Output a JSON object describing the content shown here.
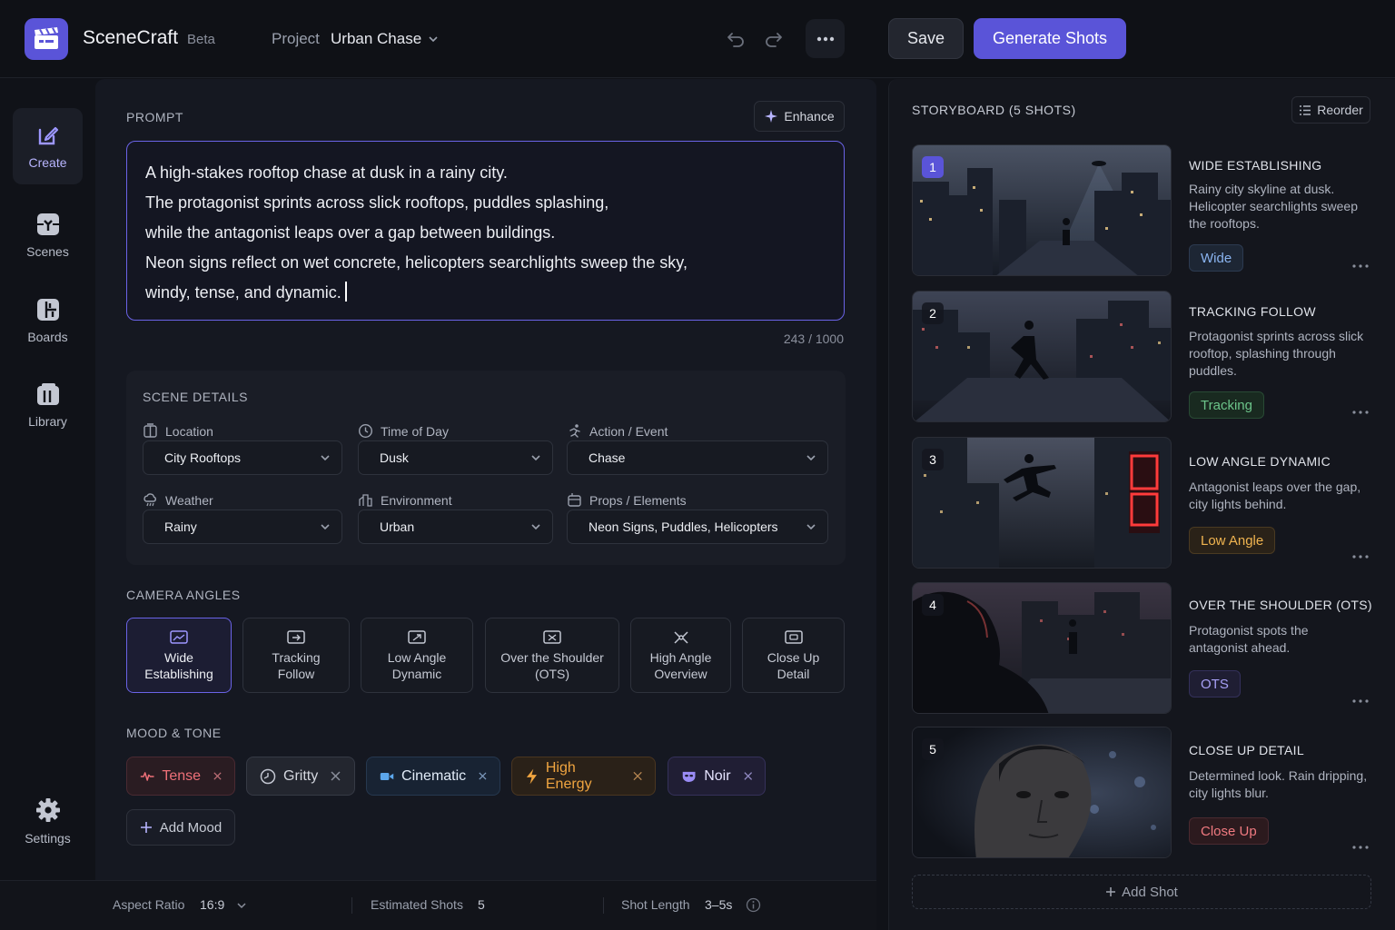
{
  "app": {
    "name": "SceneCraft",
    "badge": "Beta"
  },
  "project": {
    "label": "Project",
    "name": "Urban Chase"
  },
  "header": {
    "save_label": "Save",
    "generate_label": "Generate Shots"
  },
  "nav": {
    "items": [
      {
        "label": "Create",
        "icon": "edit-icon",
        "active": true
      },
      {
        "label": "Scenes",
        "icon": "scenes-icon"
      },
      {
        "label": "Boards",
        "icon": "boards-icon"
      },
      {
        "label": "Library",
        "icon": "library-icon"
      }
    ],
    "settings_label": "Settings"
  },
  "prompt": {
    "title": "PROMPT",
    "enhance_label": "Enhance",
    "lines": [
      "A high-stakes rooftop chase at dusk in a rainy city.",
      "The protagonist sprints across slick rooftops, puddles splashing,",
      "while the antagonist leaps over a gap between buildings.",
      "Neon signs reflect on wet concrete, helicopters searchlights sweep the sky,",
      "windy, tense, and dynamic."
    ],
    "counter": "243 / 1000"
  },
  "scene_details": {
    "title": "SCENE DETAILS",
    "fields": [
      {
        "label": "Location",
        "value": "City Rooftops"
      },
      {
        "label": "Time of Day",
        "value": "Dusk"
      },
      {
        "label": "Action / Event",
        "value": "Chase"
      },
      {
        "label": "Weather",
        "value": "Rainy"
      },
      {
        "label": "Environment",
        "value": "Urban"
      },
      {
        "label": "Props / Elements",
        "value": "Neon Signs, Puddles, Helicopters"
      }
    ]
  },
  "camera_angles": {
    "title": "CAMERA ANGLES",
    "items": [
      {
        "line1": "Wide",
        "line2": "Establishing",
        "selected": true
      },
      {
        "line1": "Tracking",
        "line2": "Follow"
      },
      {
        "line1": "Low Angle",
        "line2": "Dynamic"
      },
      {
        "line1": "Over the Shoulder",
        "line2": "(OTS)"
      },
      {
        "line1": "High Angle",
        "line2": "Overview"
      },
      {
        "line1": "Close Up",
        "line2": "Detail"
      }
    ]
  },
  "mood": {
    "title": "MOOD & TONE",
    "chips": [
      {
        "label": "Tense",
        "color": "#e8646e"
      },
      {
        "label": "Gritty",
        "color": "#c8ccd6"
      },
      {
        "label": "Cinematic",
        "color": "#5ca7ec"
      },
      {
        "label": "High Energy",
        "color": "#f0a540"
      },
      {
        "label": "Noir",
        "color": "#9a8cf5"
      }
    ],
    "add_label": "Add Mood"
  },
  "footer": {
    "aspect_label": "Aspect Ratio",
    "aspect_value": "16:9",
    "shots_label": "Estimated Shots",
    "shots_value": "5",
    "length_label": "Shot Length",
    "length_value": "3–5s"
  },
  "storyboard": {
    "title": "STORYBOARD (5 SHOTS)",
    "reorder_label": "Reorder",
    "add_label": "Add Shot",
    "shots": [
      {
        "num": "1",
        "title": "WIDE ESTABLISHING",
        "desc": "Rainy city skyline at dusk. Helicopter searchlights sweep the rooftops.",
        "tag": "Wide",
        "tag_color": "#8ab4f0"
      },
      {
        "num": "2",
        "title": "TRACKING FOLLOW",
        "desc": "Protagonist sprints across slick rooftop, splashing through puddles.",
        "tag": "Tracking",
        "tag_color": "#6cc48a"
      },
      {
        "num": "3",
        "title": "LOW ANGLE DYNAMIC",
        "desc": "Antagonist leaps over the gap, city lights behind.",
        "tag": "Low Angle",
        "tag_color": "#f0b450"
      },
      {
        "num": "4",
        "title": "OVER THE SHOULDER (OTS)",
        "desc": "Protagonist spots the antagonist ahead.",
        "tag": "OTS",
        "tag_color": "#a7a0f5"
      },
      {
        "num": "5",
        "title": "CLOSE UP DETAIL",
        "desc": "Determined look. Rain dripping, city lights blur.",
        "tag": "Close Up",
        "tag_color": "#f07a80"
      }
    ]
  }
}
